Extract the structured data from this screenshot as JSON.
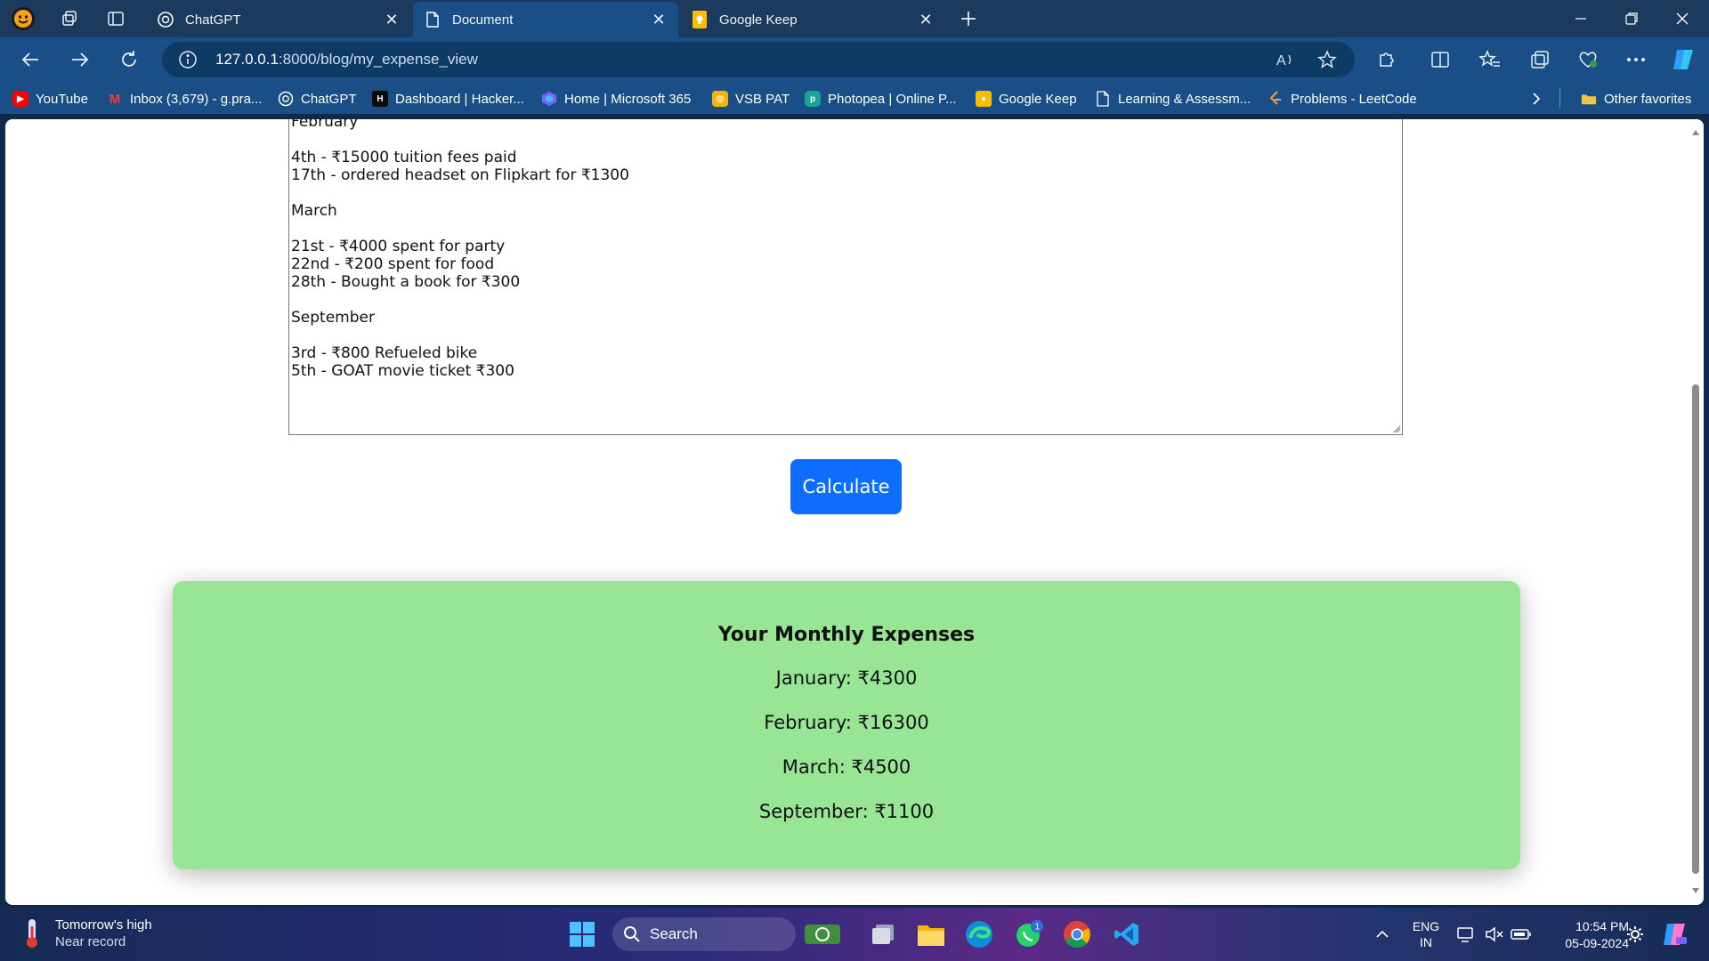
{
  "browser": {
    "tabs": [
      {
        "title": "ChatGPT",
        "icon": "chatgpt-icon",
        "active": false
      },
      {
        "title": "Document",
        "icon": "document-icon",
        "active": true
      },
      {
        "title": "Google Keep",
        "icon": "google-keep-icon",
        "active": false
      }
    ],
    "address": {
      "host": "127.0.0.1",
      "path": ":8000/blog/my_expense_view"
    },
    "bookmarks": [
      {
        "label": "YouTube",
        "icon": "youtube-icon",
        "color": "#ff0000"
      },
      {
        "label": "Inbox (3,679) - g.pra...",
        "icon": "gmail-icon",
        "color": "#ea4335"
      },
      {
        "label": "ChatGPT",
        "icon": "chatgpt-icon",
        "color": "#ffffff"
      },
      {
        "label": "Dashboard | Hacker...",
        "icon": "hackerrank-icon",
        "color": "#1ba94c"
      },
      {
        "label": "Home | Microsoft 365",
        "icon": "microsoft-365-icon",
        "color": "#7b61ff"
      },
      {
        "label": "VSB PAT",
        "icon": "vsb-icon",
        "color": "#f5b400"
      },
      {
        "label": "Photopea | Online P...",
        "icon": "photopea-icon",
        "color": "#18a497"
      },
      {
        "label": "Google Keep",
        "icon": "google-keep-icon",
        "color": "#fbbc04"
      },
      {
        "label": "Learning & Assessm...",
        "icon": "page-icon",
        "color": "#ffffff"
      },
      {
        "label": "Problems - LeetCode",
        "icon": "leetcode-icon",
        "color": "#ffa116"
      }
    ],
    "other_favorites": "Other favorites"
  },
  "page": {
    "notes_lines": [
      "February",
      "",
      "4th - ₹15000 tuition fees paid",
      "17th - ordered headset on Flipkart for ₹1300",
      "",
      "March",
      "",
      "21st - ₹4000 spent for party",
      "22nd - ₹200 spent for food",
      "28th - Bought a book for ₹300",
      "",
      "September",
      "",
      "3rd - ₹800 Refueled bike",
      "5th - GOAT movie ticket ₹300"
    ],
    "calculate_label": "Calculate",
    "result": {
      "title": "Your Monthly Expenses",
      "rows": [
        "January: ₹4300",
        "February: ₹16300",
        "March: ₹4500",
        "September: ₹1100"
      ],
      "background": "#98e595"
    },
    "button_color": "#0d6efd"
  },
  "taskbar": {
    "weather_title": "Tomorrow's high",
    "weather_sub": "Near record",
    "search_label": "Search",
    "whatsapp_badge": "1",
    "lang_top": "ENG",
    "lang_bottom": "IN",
    "time": "10:54 PM",
    "date": "05-09-2024"
  }
}
